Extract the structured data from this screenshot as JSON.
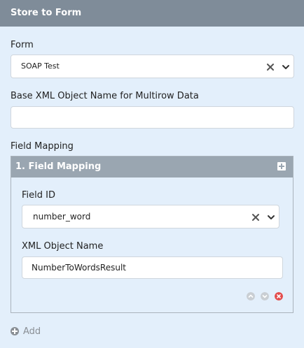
{
  "panel": {
    "title": "Store to Form"
  },
  "form": {
    "label": "Form",
    "selected": "SOAP Test"
  },
  "base_xml": {
    "label": "Base XML Object Name for Multirow Data",
    "value": ""
  },
  "field_mapping": {
    "label": "Field Mapping",
    "item_header": "1. Field Mapping",
    "field_id": {
      "label": "Field ID",
      "selected": "number_word"
    },
    "xml_object_name": {
      "label": "XML Object Name",
      "value": "NumberToWordsResult"
    }
  },
  "add": {
    "label": "Add"
  },
  "colors": {
    "background": "#e3effb",
    "panel_header": "#7f8c99",
    "mapping_header": "#9aa6b1",
    "remove_red": "#e34d4d",
    "disabled_grey": "#c9ced3"
  }
}
